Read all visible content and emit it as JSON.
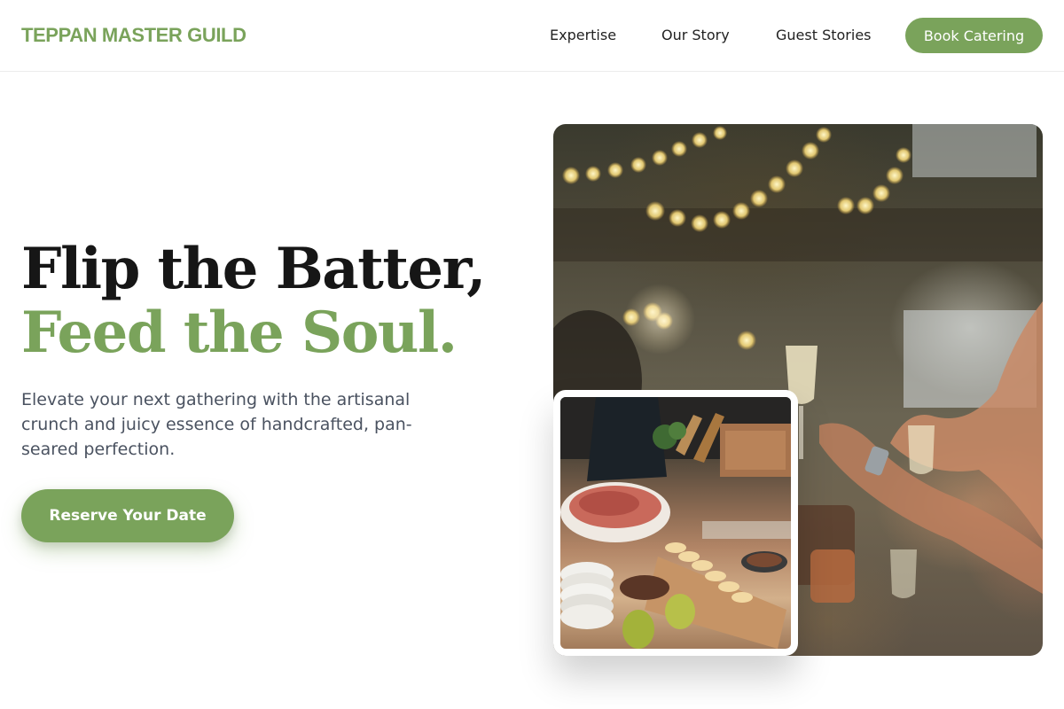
{
  "header": {
    "brand": "TEPPAN MASTER GUILD",
    "nav": [
      "Expertise",
      "Our Story",
      "Guest Stories"
    ],
    "cta": "Book Catering"
  },
  "hero": {
    "headline_line1": "Flip the Batter,",
    "headline_line2": "Feed the Soul.",
    "subcopy": "Elevate your next gathering with the artisanal crunch and juicy essence of handcrafted, pan-seared perfection.",
    "cta": "Reserve Your Date"
  },
  "images": {
    "main_photo": "Festive celebration with string lights and champagne toast",
    "inset_photo": "Catering buffet spread with charcuterie, bread and pears"
  },
  "colors": {
    "accent": "#7aa35b",
    "headline": "#161616",
    "body_text": "#4a5260"
  }
}
